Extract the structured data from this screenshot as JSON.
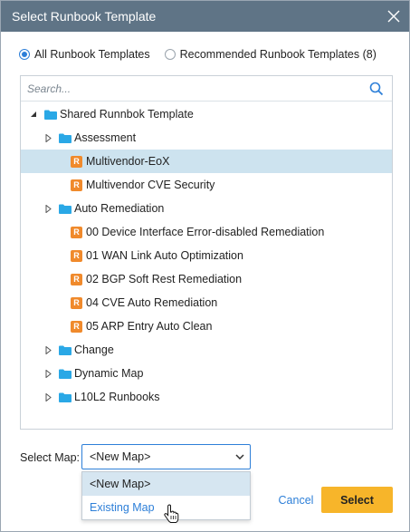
{
  "dialog": {
    "title": "Select Runbook Template"
  },
  "radios": {
    "all": "All Runbook Templates",
    "recommended": "Recommended Runbook Templates (8)",
    "selected": "all"
  },
  "search": {
    "placeholder": "Search..."
  },
  "tree": {
    "root": "Shared Runnbok Template",
    "items": [
      {
        "label": "Assessment",
        "type": "folder"
      },
      {
        "label": "Multivendor-EoX",
        "type": "runbook",
        "selected": true
      },
      {
        "label": "Multivendor CVE Security",
        "type": "runbook"
      },
      {
        "label": "Auto Remediation",
        "type": "folder"
      },
      {
        "label": "00 Device Interface Error-disabled Remediation",
        "type": "runbook"
      },
      {
        "label": "01 WAN Link Auto Optimization",
        "type": "runbook"
      },
      {
        "label": "02 BGP Soft Rest Remediation",
        "type": "runbook"
      },
      {
        "label": "04 CVE Auto Remediation",
        "type": "runbook"
      },
      {
        "label": "05 ARP Entry Auto Clean",
        "type": "runbook"
      },
      {
        "label": "Change",
        "type": "folder"
      },
      {
        "label": "Dynamic Map",
        "type": "folder"
      },
      {
        "label": "L10L2 Runbooks",
        "type": "folder"
      }
    ],
    "runbook_icon_letter": "R"
  },
  "map": {
    "label": "Select Map:",
    "value": "<New Map>",
    "options": [
      "<New Map>",
      "Existing Map"
    ]
  },
  "buttons": {
    "cancel": "Cancel",
    "select": "Select"
  },
  "colors": {
    "titlebar": "#5f7486",
    "accent": "#2d7fd8",
    "primary_button": "#f7b52a",
    "folder": "#2aa8e6",
    "runbook_icon": "#f08a2c",
    "selected_row": "#cde3ef"
  }
}
